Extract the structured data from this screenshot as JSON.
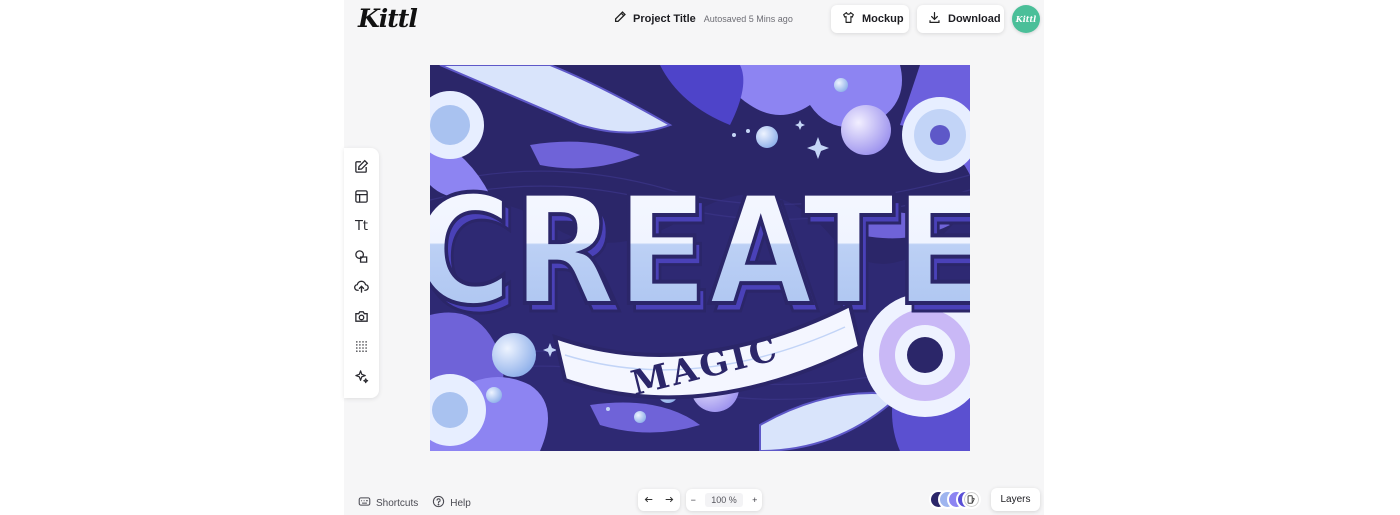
{
  "app": {
    "logo_text": "Kittl"
  },
  "header": {
    "project_title": "Project Title",
    "autosave_status": "Autosaved 5 Mins ago",
    "mockup_label": "Mockup",
    "download_label": "Download",
    "avatar_text": "Kittl",
    "avatar_color": "#4bbf99"
  },
  "toolbar": {
    "tools": [
      {
        "icon": "edit-icon"
      },
      {
        "icon": "templates-icon"
      },
      {
        "icon": "text-icon",
        "label": "Tt"
      },
      {
        "icon": "shapes-icon"
      },
      {
        "icon": "upload-icon"
      },
      {
        "icon": "camera-icon"
      },
      {
        "icon": "texture-icon"
      },
      {
        "icon": "sparkle-icon"
      }
    ]
  },
  "artwork": {
    "headline": "CREATE",
    "banner_text": "MAGIC",
    "palette": {
      "background": "#2b2669",
      "accent": "#8d84f2",
      "light": "#b9cdf3",
      "white": "#f5f7ff"
    }
  },
  "footer": {
    "shortcuts_label": "Shortcuts",
    "help_label": "Help",
    "zoom_minus": "−",
    "zoom_value": "100 %",
    "zoom_plus": "+",
    "layers_label": "Layers",
    "swatch_colors": [
      "#2b2669",
      "#9fb5ef",
      "#8d84f2",
      "#5a4fd6"
    ]
  }
}
